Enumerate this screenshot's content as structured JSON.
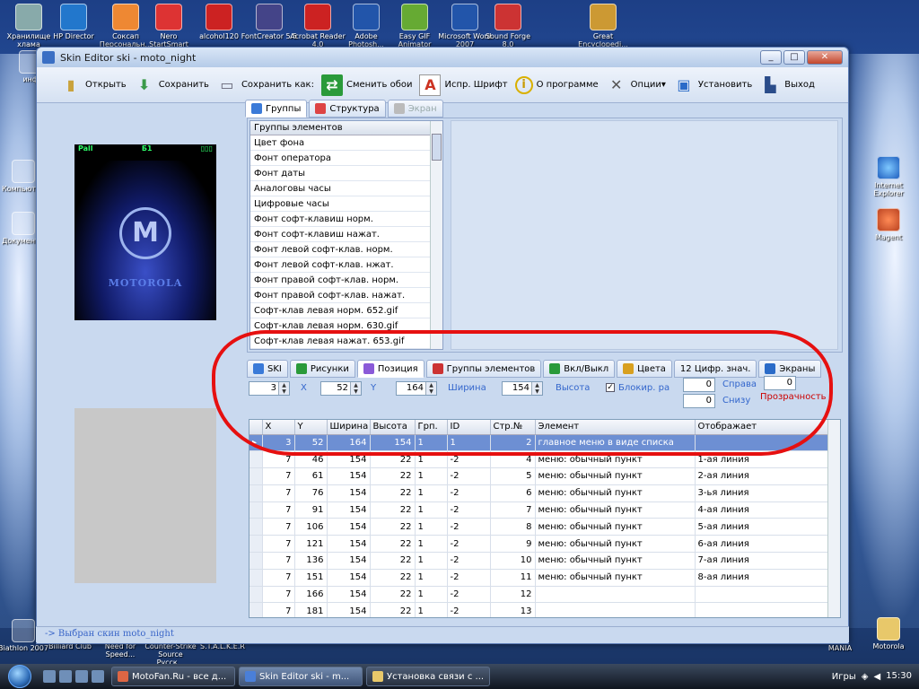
{
  "desktop": {
    "top_icons": [
      {
        "label": "Хранилище хлама"
      },
      {
        "label": "HP Director"
      },
      {
        "label": "Соксап Персональн..."
      },
      {
        "label": "Nero StartSmart"
      },
      {
        "label": "alcohol120"
      },
      {
        "label": "FontCreator 5.5"
      },
      {
        "label": "Acrobat Reader 4.0"
      },
      {
        "label": "Adobe Photosh..."
      },
      {
        "label": "Easy GIF Animator"
      },
      {
        "label": "Microsoft Word 2007"
      },
      {
        "label": "Sound Forge 8.0"
      },
      {
        "label": "Great Encyclopedi..."
      }
    ],
    "left_icons": [
      {
        "label": "инф"
      },
      {
        "label": "Компьютер"
      },
      {
        "label": "Документы"
      },
      {
        "label": "Biathlon 2007"
      }
    ],
    "right_icons": [
      {
        "label": "Internet Explorer"
      },
      {
        "label": "Magent"
      },
      {
        "label": "Motorola"
      }
    ],
    "bottom_icons": [
      {
        "label": "Billiard Club"
      },
      {
        "label": "Need for Speed..."
      },
      {
        "label": "Counter-Strike Source Русск..."
      },
      {
        "label": "S.T.A.L.K.E.R"
      }
    ],
    "right_bottom_labels": [
      "MANIA"
    ]
  },
  "window": {
    "title": "Skin Editor  ski - moto_night",
    "buttons": {
      "min": "_",
      "max": "□",
      "close": "✕"
    }
  },
  "toolbar": {
    "items": [
      {
        "label": "Открыть",
        "icon": "folder-open-icon"
      },
      {
        "label": "Сохранить",
        "icon": "save-icon"
      },
      {
        "label": "Сохранить как:",
        "icon": "save-as-icon"
      },
      {
        "label": "Сменить обои",
        "icon": "change-wallpaper-icon"
      },
      {
        "label": "Испр. Шрифт",
        "icon": "font-icon"
      },
      {
        "label": "О программе",
        "icon": "info-icon"
      },
      {
        "label": "Опции",
        "icon": "options-icon"
      },
      {
        "label": "Установить",
        "icon": "install-icon"
      },
      {
        "label": "Выход",
        "icon": "exit-icon"
      }
    ]
  },
  "phone_preview": {
    "status_left": "Pall",
    "status_mid": "Б1",
    "status_right": "▯▯▯",
    "logo_letter": "M",
    "brand": "MOTOROLA"
  },
  "tabs_top": [
    {
      "label": "Группы",
      "active": true
    },
    {
      "label": "Структура",
      "active": false
    },
    {
      "label": "Экран",
      "active": false,
      "disabled": true
    }
  ],
  "groups": {
    "header": "Группы элементов",
    "items": [
      "Цвет фона",
      "Фонт оператора",
      "Фонт даты",
      "Аналоговы часы",
      "Цифровые часы",
      "Фонт софт-клавиш норм.",
      "Фонт софт-клавиш нажат.",
      "Фонт левой софт-клав. норм.",
      "Фонт левой софт-клав. нжат.",
      "Фонт правой софт-клав. норм.",
      "Фонт правой софт-клав. нажат.",
      "Софт-клав левая норм. 652.gif",
      "Софт-клав левая норм. 630.gif",
      "Софт-клав левая нажат. 653.gif"
    ]
  },
  "tabs_mid": [
    {
      "label": "SKI"
    },
    {
      "label": "Рисунки"
    },
    {
      "label": "Позиция",
      "active": true
    },
    {
      "label": "Группы элементов"
    },
    {
      "label": "Вкл/Выкл"
    },
    {
      "label": "Цвета"
    },
    {
      "label": "12 Цифр. знач."
    },
    {
      "label": "Экраны"
    }
  ],
  "position": {
    "v1": "3",
    "x_label": "X",
    "x_val": "52",
    "y_label": "Y",
    "y_val": "164",
    "width_label": "Ширина",
    "width_val": "154",
    "height_label": "Высота",
    "lock_label": "Блокир. ра",
    "lock_checked": true,
    "right_label": "Справа",
    "right_val": "0",
    "bottom_label": "Снизу",
    "bottom_val": "0",
    "transparency_label": "Прозрачность",
    "transparency_val": "0"
  },
  "grid": {
    "columns": [
      "X",
      "Y",
      "Ширина",
      "Высота",
      "Грп.",
      "ID",
      "Стр.№",
      "Элемент",
      "Отображает"
    ],
    "rows": [
      [
        "3",
        "52",
        "164",
        "154",
        "1",
        "1",
        "2",
        "главное меню в виде списка",
        ""
      ],
      [
        "7",
        "46",
        "154",
        "22",
        "1",
        "-2",
        "4",
        "меню: обычный пункт",
        "1-ая линия"
      ],
      [
        "7",
        "61",
        "154",
        "22",
        "1",
        "-2",
        "5",
        "меню: обычный пункт",
        "2-ая линия"
      ],
      [
        "7",
        "76",
        "154",
        "22",
        "1",
        "-2",
        "6",
        "меню: обычный пункт",
        "3-ья линия"
      ],
      [
        "7",
        "91",
        "154",
        "22",
        "1",
        "-2",
        "7",
        "меню: обычный пункт",
        "4-ая линия"
      ],
      [
        "7",
        "106",
        "154",
        "22",
        "1",
        "-2",
        "8",
        "меню: обычный пункт",
        "5-ая линия"
      ],
      [
        "7",
        "121",
        "154",
        "22",
        "1",
        "-2",
        "9",
        "меню: обычный пункт",
        "6-ая линия"
      ],
      [
        "7",
        "136",
        "154",
        "22",
        "1",
        "-2",
        "10",
        "меню: обычный пункт",
        "7-ая линия"
      ],
      [
        "7",
        "151",
        "154",
        "22",
        "1",
        "-2",
        "11",
        "меню: обычный пункт",
        "8-ая линия"
      ],
      [
        "7",
        "166",
        "154",
        "22",
        "1",
        "-2",
        "12",
        "",
        ""
      ],
      [
        "7",
        "181",
        "154",
        "22",
        "1",
        "-2",
        "13",
        "",
        ""
      ]
    ]
  },
  "status": "-> Выбран скин moto_night",
  "taskbar": {
    "tasks": [
      {
        "label": "MotoFan.Ru - все д..."
      },
      {
        "label": "Skin Editor  ski - m...",
        "active": true
      },
      {
        "label": "Установка связи с ..."
      }
    ],
    "tray_text": "Игры",
    "clock_time": "15:30"
  },
  "colors": {
    "accent": "#6d8fd3",
    "highlight_oval": "#e61010",
    "status_text": "#3a66c8",
    "transparency_label": "#cc0000"
  }
}
